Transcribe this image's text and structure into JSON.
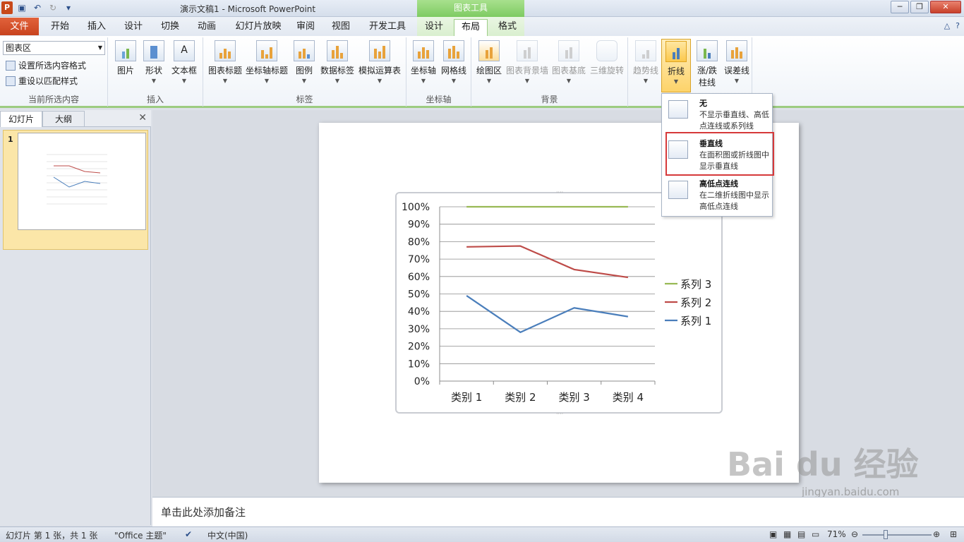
{
  "window": {
    "title": "演示文稿1 - Microsoft PowerPoint",
    "context_group": "图表工具",
    "app_logo": "P"
  },
  "tabs": {
    "file": "文件",
    "items": [
      "开始",
      "插入",
      "设计",
      "切换",
      "动画",
      "幻灯片放映",
      "审阅",
      "视图",
      "开发工具",
      "设计",
      "布局",
      "格式"
    ],
    "active": "布局"
  },
  "ribbon": {
    "current_selection": {
      "dropdown_value": "图表区",
      "format_selection": "设置所选内容格式",
      "reset_style": "重设以匹配样式",
      "label": "当前所选内容"
    },
    "insert": {
      "label": "插入",
      "picture": "图片",
      "shapes": "形状",
      "textbox": "文本框"
    },
    "labels": {
      "label": "标签",
      "chart_title": "图表标题",
      "axis_titles": "坐标轴标题",
      "legend": "图例",
      "data_labels": "数据标签",
      "data_table": "模拟运算表"
    },
    "axes": {
      "label": "坐标轴",
      "axes": "坐标轴",
      "gridlines": "网格线"
    },
    "background": {
      "label": "背景",
      "plot_area": "绘图区",
      "chart_wall": "图表背景墙",
      "chart_floor": "图表基底",
      "rotation_3d": "三维旋转"
    },
    "analysis": {
      "trendline": "趋势线",
      "lines": "折线",
      "updown_bars_1": "涨/跌",
      "updown_bars_2": "柱线",
      "error_bars": "误差线"
    }
  },
  "lines_menu": {
    "items": [
      {
        "title": "无",
        "desc": "不显示垂直线、高低点连线或系列线"
      },
      {
        "title": "垂直线",
        "desc": "在面积图或折线图中显示垂直线"
      },
      {
        "title": "高低点连线",
        "desc": "在二维折线图中显示高低点连线"
      }
    ]
  },
  "left_pane": {
    "tab_slides": "幻灯片",
    "tab_outline": "大纲",
    "slide_number": "1"
  },
  "notes": {
    "placeholder": "单击此处添加备注"
  },
  "status": {
    "slide_info": "幻灯片 第 1 张，共 1 张",
    "theme": "\"Office 主题\"",
    "language": "中文(中国)",
    "zoom": "71%"
  },
  "watermark": {
    "text": "Bai du 经验",
    "url": "jingyan.baidu.com"
  },
  "colors": {
    "series1": "#4a7ebb",
    "series2": "#be4b48",
    "series3": "#98b954",
    "ribbon_accent": "#9ccc80",
    "file_tab": "#c8431e"
  },
  "chart_data": {
    "type": "line",
    "categories": [
      "类别 1",
      "类别 2",
      "类别 3",
      "类别 4"
    ],
    "series": [
      {
        "name": "系列 1",
        "values": [
          49,
          28,
          42,
          37
        ]
      },
      {
        "name": "系列 2",
        "values": [
          77,
          77.5,
          64,
          59.5
        ]
      },
      {
        "name": "系列 3",
        "values": [
          100,
          100,
          100,
          100
        ]
      }
    ],
    "ylim": [
      0,
      100
    ],
    "yticks": [
      "0%",
      "10%",
      "20%",
      "30%",
      "40%",
      "50%",
      "60%",
      "70%",
      "80%",
      "90%",
      "100%"
    ],
    "legend": "right",
    "legend_order": [
      "系列 3",
      "系列 2",
      "系列 1"
    ],
    "grid": true
  }
}
